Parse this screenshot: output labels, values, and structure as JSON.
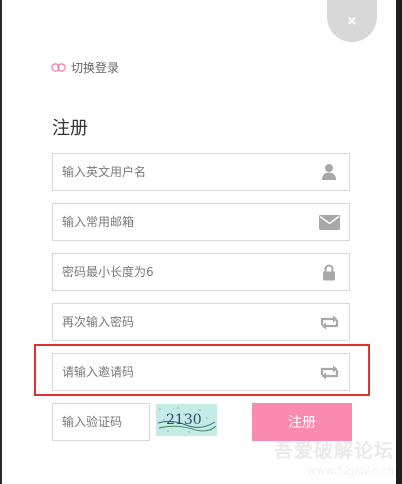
{
  "close": {
    "label": "×"
  },
  "switch_login": {
    "label": "切换登录"
  },
  "title": "注册",
  "fields": {
    "username": {
      "placeholder": "输入英文用户名",
      "icon": "user-icon"
    },
    "email": {
      "placeholder": "输入常用邮箱",
      "icon": "mail-icon"
    },
    "password": {
      "placeholder": "密码最小长度为6",
      "icon": "lock-icon"
    },
    "password_confirm": {
      "placeholder": "再次输入密码",
      "icon": "repeat-icon"
    },
    "invite_code": {
      "placeholder": "请输入邀请码",
      "icon": "repeat-icon"
    },
    "captcha": {
      "placeholder": "输入验证码"
    }
  },
  "captcha_image_text": "2130",
  "submit": {
    "label": "注册"
  },
  "watermark": {
    "main": "吾爱破解论坛",
    "sub": "www.52pojie.cn"
  },
  "colors": {
    "accent": "#f98ab0",
    "highlight": "#e0312f",
    "icon": "#a8a8a8"
  }
}
